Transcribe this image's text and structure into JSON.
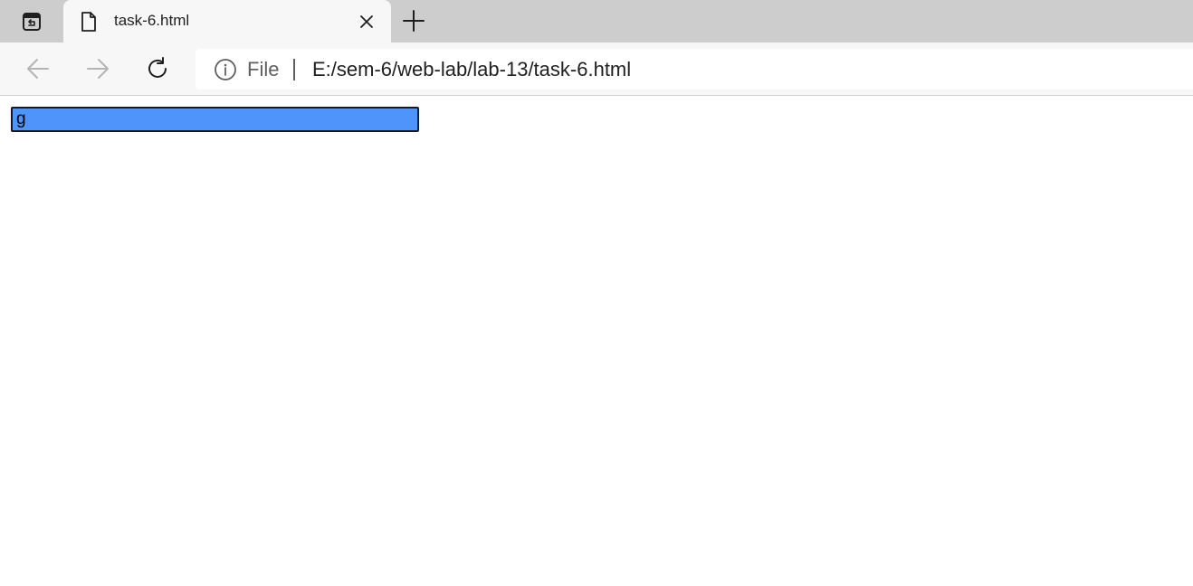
{
  "browser": {
    "tab": {
      "title": "task-6.html"
    },
    "address_bar": {
      "scheme_label": "File",
      "url": "E:/sem-6/web-lab/lab-13/task-6.html"
    },
    "icons": {
      "tab_actions": "tab-actions-icon",
      "favicon": "page-icon",
      "close": "close-icon",
      "new_tab": "plus-icon",
      "back": "arrow-left-icon",
      "forward": "arrow-right-icon",
      "reload": "reload-icon",
      "info": "info-icon"
    }
  },
  "page": {
    "input": {
      "value": "g",
      "background": "#4e94fb",
      "border": "#1a1a1a"
    }
  }
}
